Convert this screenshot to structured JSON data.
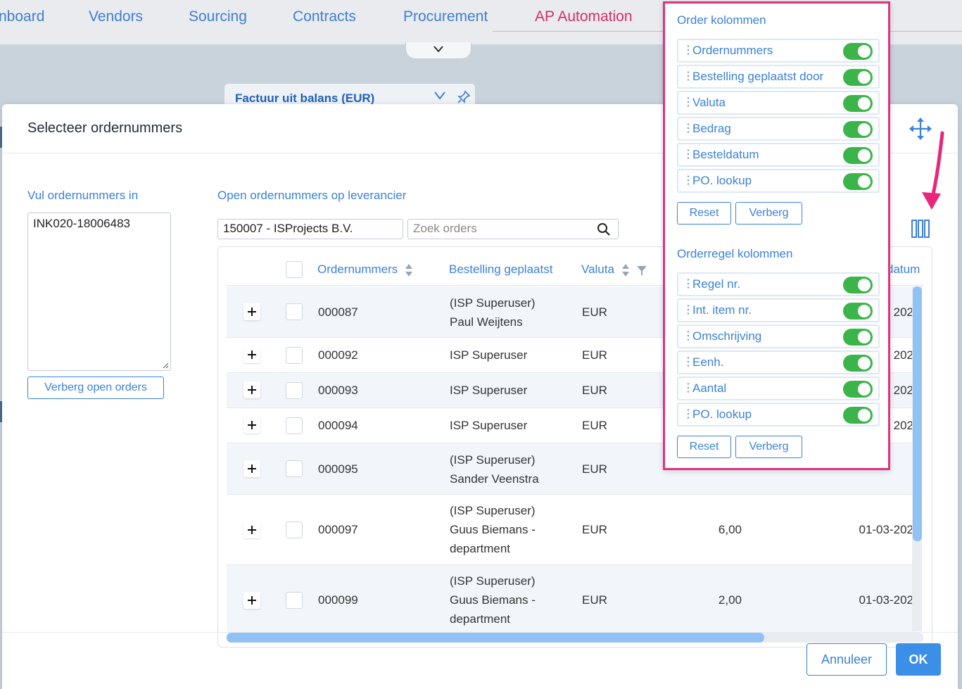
{
  "nav": {
    "items": [
      {
        "label": "nboard",
        "active": false
      },
      {
        "label": "Vendors",
        "active": false
      },
      {
        "label": "Sourcing",
        "active": false
      },
      {
        "label": "Contracts",
        "active": false
      },
      {
        "label": "Procurement",
        "active": false
      },
      {
        "label": "AP Automation",
        "active": true
      }
    ]
  },
  "bg_card": {
    "title": "Factuur uit balans (EUR)"
  },
  "modal": {
    "title": "Selecteer ordernummers",
    "left_label": "Vul ordernummers in",
    "ordernr_value": "INK020-18006483",
    "hide_open_orders": "Verberg open orders",
    "right_label": "Open ordernummers op leverancier",
    "vendor_value": "150007 - ISProjects B.V.",
    "search_placeholder": "Zoek orders",
    "cancel": "Annuleer",
    "ok": "OK"
  },
  "table": {
    "headers": {
      "ordernummers": "Ordernummers",
      "geplaatst": "Bestelling geplaatst",
      "valuta": "Valuta",
      "datum": "datum"
    },
    "rows": [
      {
        "nr": "000087",
        "by1": "(ISP Superuser)",
        "by2": "Paul Weijtens",
        "by3": "",
        "cur": "EUR",
        "amount": "",
        "date": "202"
      },
      {
        "nr": "000092",
        "by1": "ISP Superuser",
        "by2": "",
        "by3": "",
        "cur": "EUR",
        "amount": "",
        "date": "202"
      },
      {
        "nr": "000093",
        "by1": "ISP Superuser",
        "by2": "",
        "by3": "",
        "cur": "EUR",
        "amount": "",
        "date": "202"
      },
      {
        "nr": "000094",
        "by1": "ISP Superuser",
        "by2": "",
        "by3": "",
        "cur": "EUR",
        "amount": "",
        "date": "202"
      },
      {
        "nr": "000095",
        "by1": "(ISP Superuser)",
        "by2": "Sander Veenstra",
        "by3": "",
        "cur": "EUR",
        "amount": "",
        "date": ""
      },
      {
        "nr": "000097",
        "by1": "(ISP Superuser)",
        "by2": "Guus Biemans -",
        "by3": "department",
        "cur": "EUR",
        "amount": "6,00",
        "date": "01-03-202"
      },
      {
        "nr": "000099",
        "by1": "(ISP Superuser)",
        "by2": "Guus Biemans -",
        "by3": "department",
        "cur": "EUR",
        "amount": "2,00",
        "date": "01-03-202"
      }
    ]
  },
  "column_panel": {
    "order_title": "Order kolommen",
    "order_columns": [
      {
        "label": "Ordernummers",
        "enabled": true
      },
      {
        "label": "Bestelling geplaatst door",
        "enabled": true
      },
      {
        "label": "Valuta",
        "enabled": true
      },
      {
        "label": "Bedrag",
        "enabled": true
      },
      {
        "label": "Besteldatum",
        "enabled": true
      },
      {
        "label": "PO. lookup",
        "enabled": true
      }
    ],
    "line_title": "Orderregel kolommen",
    "line_columns": [
      {
        "label": "Regel nr.",
        "enabled": true
      },
      {
        "label": "Int. item nr.",
        "enabled": true
      },
      {
        "label": "Omschrijving",
        "enabled": true
      },
      {
        "label": "Eenh.",
        "enabled": true
      },
      {
        "label": "Aantal",
        "enabled": true
      },
      {
        "label": "PO. lookup",
        "enabled": true
      }
    ],
    "reset": "Reset",
    "hide": "Verberg"
  },
  "colors": {
    "accent": "#3b82d6",
    "active_nav": "#d0306a",
    "highlight_border": "#e0317e",
    "toggle_on": "#3bb54a",
    "annotation_arrow": "#e8277a"
  }
}
